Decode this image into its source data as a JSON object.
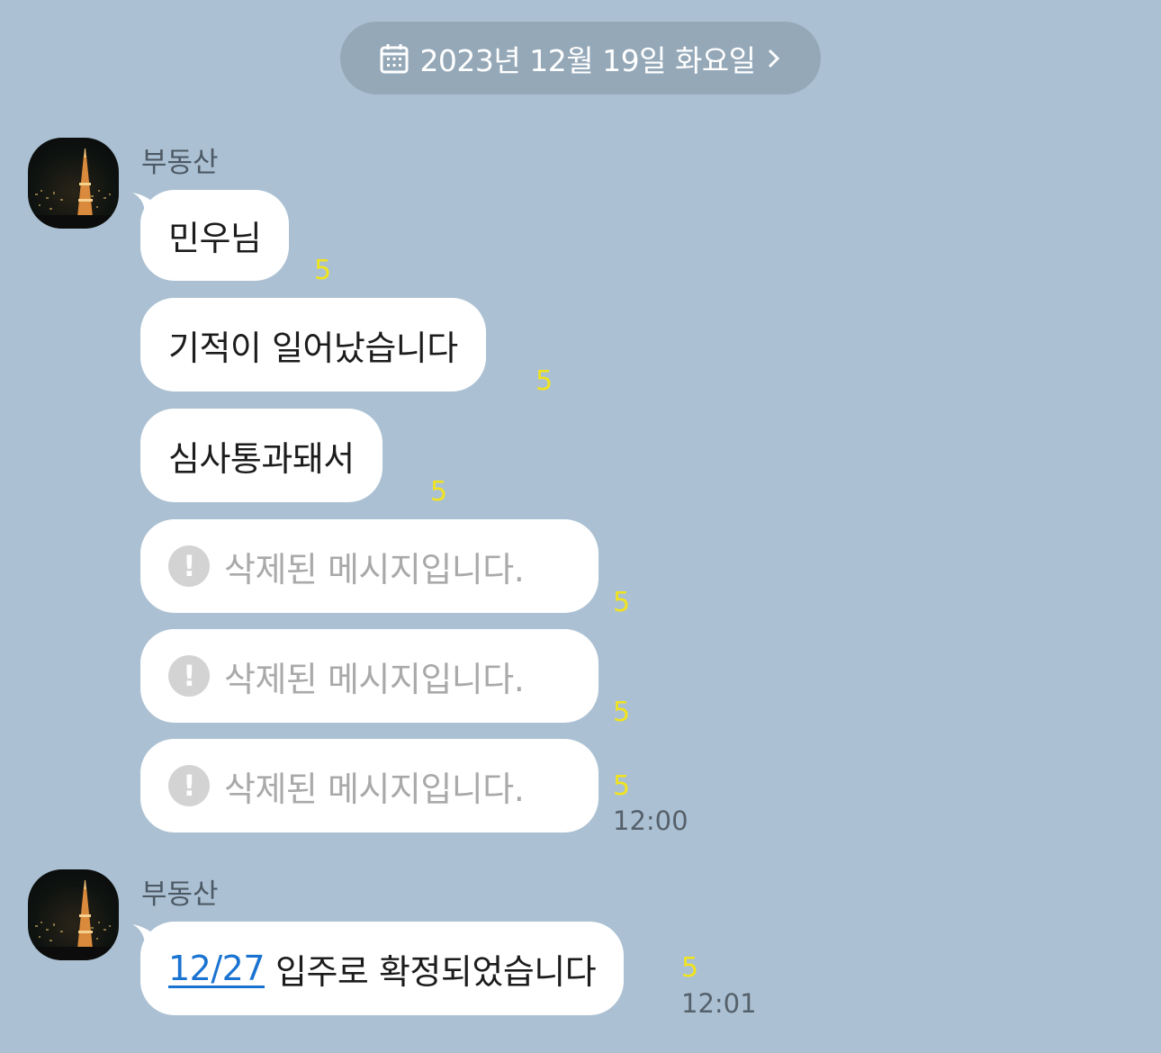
{
  "date_divider": {
    "label": "2023년 12월 19일 화요일",
    "icon": "calendar-icon",
    "chevron": "chevron-right-icon"
  },
  "groups": [
    {
      "sender": "부동산",
      "messages": [
        {
          "text": "민우님",
          "unread": "5"
        },
        {
          "text": "기적이 일어났습니다",
          "unread": "5"
        },
        {
          "text": "심사통과돼서",
          "unread": "5"
        },
        {
          "text": "삭제된 메시지입니다.",
          "unread": "5",
          "deleted": true
        },
        {
          "text": "삭제된 메시지입니다.",
          "unread": "5",
          "deleted": true
        },
        {
          "text": "삭제된 메시지입니다.",
          "unread": "5",
          "deleted": true,
          "time": "12:00"
        }
      ]
    },
    {
      "sender": "부동산",
      "messages": [
        {
          "link": "12/27",
          "text": "입주로 확정되었습니다",
          "unread": "5",
          "time": "12:01"
        }
      ]
    }
  ],
  "colors": {
    "background": "#abc1d3",
    "bubble": "#ffffff",
    "unread": "#f1e31e",
    "link": "#1a73d1"
  }
}
